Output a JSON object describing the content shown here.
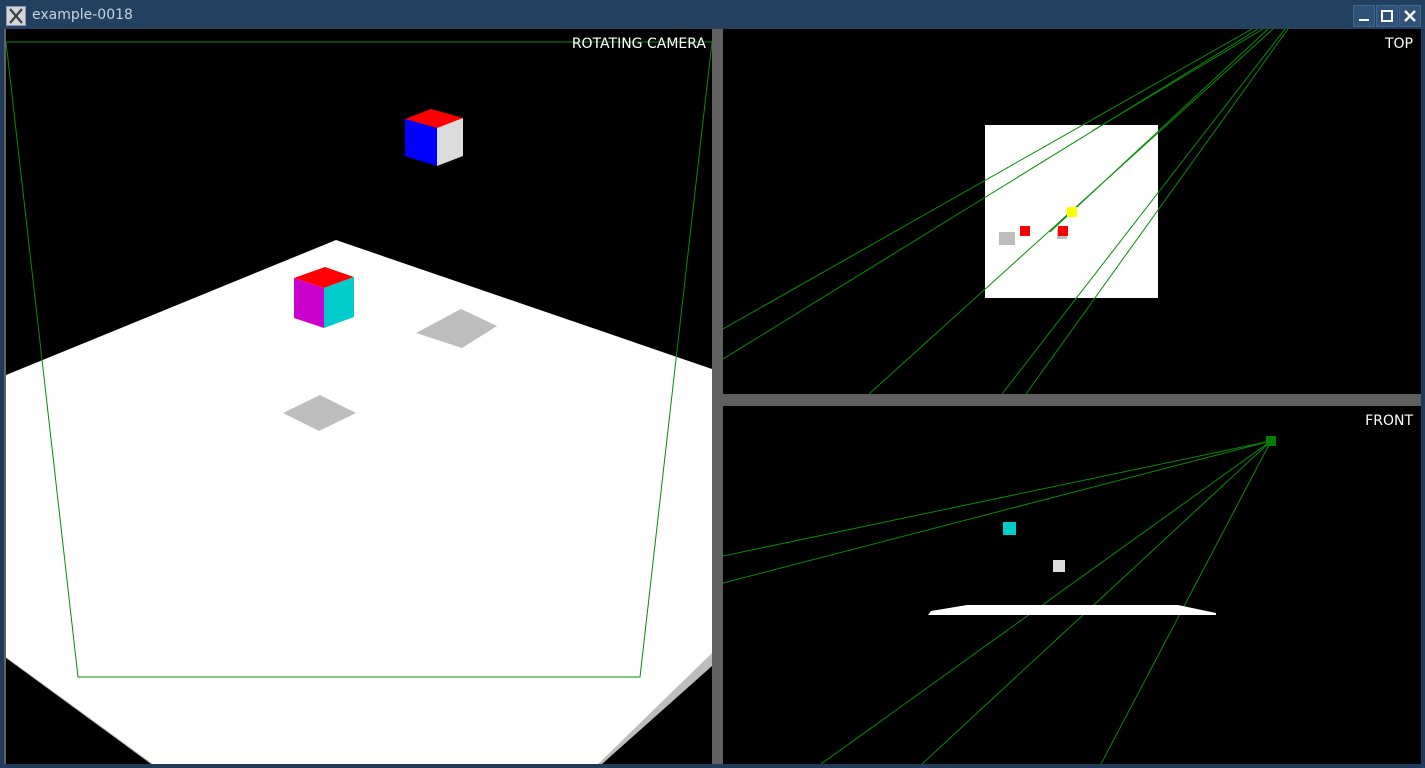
{
  "window": {
    "title": "example-0018",
    "controls": [
      "minimize-icon",
      "maximize-icon",
      "close-icon"
    ]
  },
  "viewports": {
    "rotating": {
      "label": "ROTATING CAMERA"
    },
    "top": {
      "label": "TOP"
    },
    "front": {
      "label": "FRONT"
    }
  },
  "colors": {
    "titlebar": "#23405f",
    "viewport_bg": "#000000",
    "frustum_line": "#0a8a0a",
    "floor": "#ffffff",
    "floor_edge": "#bdbdbd",
    "shadow": "#bdbdbd",
    "cube_red": "#ff0000",
    "cube_blue": "#0000ff",
    "cube_white": "#dcdcdc",
    "cube_magenta": "#cc00cc",
    "cube_cyan": "#00cccc",
    "marker_yellow": "#ffff00",
    "marker_green": "#008000"
  }
}
